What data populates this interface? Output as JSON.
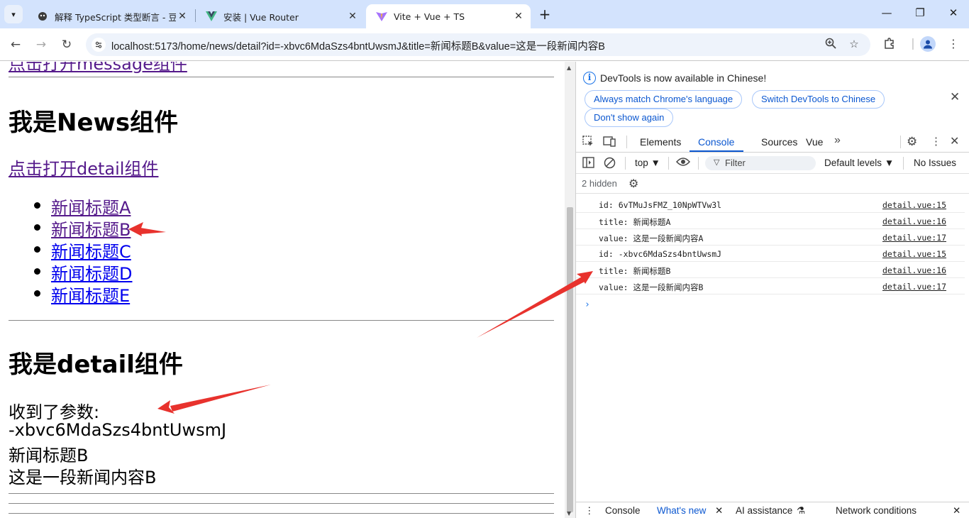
{
  "browser": {
    "tabs": [
      {
        "title": "解释 TypeScript 类型断言 - 豆",
        "icon": "doubao-icon"
      },
      {
        "title": "安装 | Vue Router",
        "icon": "vue-icon"
      },
      {
        "title": "Vite + Vue + TS",
        "icon": "vite-icon",
        "active": true
      }
    ],
    "url": "localhost:5173/home/news/detail?id=-xbvc6MdaSzs4bntUwsmJ&title=新闻标题B&value=这是一段新闻内容B"
  },
  "page": {
    "top_clipped_link": "点击打开message组件",
    "news_heading": "我是News组件",
    "detail_link": "点击打开detail组件",
    "news_items": [
      "新闻标题A",
      "新闻标题B",
      "新闻标题C",
      "新闻标题D",
      "新闻标题E"
    ],
    "detail_heading": "我是detail组件",
    "received_label": "收到了参数:",
    "param_id": "-xbvc6MdaSzs4bntUwsmJ",
    "param_title": "新闻标题B",
    "param_value": "这是一段新闻内容B"
  },
  "devtools": {
    "banner": {
      "message": "DevTools is now available in Chinese!",
      "btn_match": "Always match Chrome's language",
      "btn_switch": "Switch DevTools to Chinese",
      "btn_dont_show": "Don't show again"
    },
    "tabs": [
      "Elements",
      "Console",
      "Sources",
      "Vue"
    ],
    "active_tab": "Console",
    "context": "top",
    "filter_placeholder": "Filter",
    "levels": "Default levels",
    "issues": "No Issues",
    "hidden": "2 hidden",
    "logs": [
      {
        "msg": "id: 6vTMuJsFMZ_10NpWTVw3l",
        "src": "detail.vue:15"
      },
      {
        "msg": "title: 新闻标题A",
        "src": "detail.vue:16"
      },
      {
        "msg": "value: 这是一段新闻内容A",
        "src": "detail.vue:17"
      },
      {
        "msg": "id: -xbvc6MdaSzs4bntUwsmJ",
        "src": "detail.vue:15"
      },
      {
        "msg": "title: 新闻标题B",
        "src": "detail.vue:16"
      },
      {
        "msg": "value: 这是一段新闻内容B",
        "src": "detail.vue:17"
      }
    ],
    "drawer": {
      "console": "Console",
      "whats_new": "What's new",
      "ai": "AI assistance",
      "network": "Network conditions"
    }
  },
  "colors": {
    "accent": "#0b57d0",
    "annotation_arrow": "#e8322d",
    "tabstrip": "#d3e3fd"
  }
}
